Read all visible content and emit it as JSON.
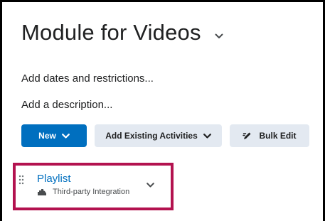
{
  "module": {
    "title": "Module for Videos",
    "title_chevron_icon": "chevron-down-icon"
  },
  "links": {
    "dates": "Add dates and restrictions...",
    "description": "Add a description..."
  },
  "toolbar": {
    "new_label": "New",
    "existing_label": "Add Existing Activities",
    "bulk_edit_label": "Bulk Edit",
    "bulk_edit_icon": "pencil-icon"
  },
  "activity": {
    "name": "Playlist",
    "type": "Third-party Integration",
    "type_icon": "puzzle-icon",
    "handle_icon": "drag-handle-icon"
  },
  "colors": {
    "primary": "#006fbf",
    "secondary": "#e3e9f1",
    "highlight": "#b3124f"
  }
}
